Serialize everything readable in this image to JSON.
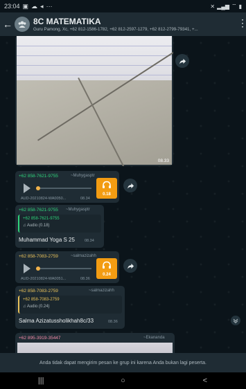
{
  "status_bar": {
    "time": "23:04",
    "left_icons": [
      "image-icon",
      "cloud-icon",
      "send-icon",
      "more-icon"
    ],
    "right_icons": [
      "mute-icon",
      "signal-icon",
      "wifi-icon",
      "battery-icon"
    ]
  },
  "header": {
    "title": "8C MATEMATIKA",
    "subtitle": "Guru Pamong, Xc, +62 812-1586-1782, +62 812-2597-1279, +62 812-2799-79341, +..."
  },
  "messages": {
    "image": {
      "time": "08.33"
    },
    "audio1": {
      "sender": "+62 858-7621-9755",
      "alias": "~Muhygasptr",
      "file": "AUD-20210824-WA0050...",
      "time": "08.34",
      "duration": "0.18"
    },
    "reply1": {
      "sender": "+62 858-7621-9755",
      "alias": "~Muhygasptr",
      "quote_sender": "+62 858-7621-9755",
      "quote_text": "Audio (0.18)",
      "text": "Muhammad Yoga S 25",
      "time": "08.34"
    },
    "audio2": {
      "sender": "+62 858-7083-2759",
      "alias": "~salmazizahh",
      "file": "AUD-20210824-WA0051...",
      "time": "08.36",
      "duration": "0.24"
    },
    "reply2": {
      "sender": "+62 858-7083-2759",
      "alias": "~salmazizahh",
      "quote_sender": "+62 858-7083-2759",
      "quote_text": "Audio (0.24)",
      "text": "Salma Azizatussholikhah8c/33",
      "time": "08.36"
    },
    "partial": {
      "sender": "+62 895-3919-35447",
      "alias": "~Ekananda"
    }
  },
  "footer": {
    "notice": "Anda tidak dapat mengirim pesan ke grup ini karena Anda bukan lagi peserta."
  },
  "navbar": {
    "recents": "|||",
    "home": "○",
    "back": "<"
  },
  "colors": {
    "header_bg": "#1f2c34",
    "bubble_bg": "#1f2c34",
    "audio_accent": "#f39c12",
    "sender_green": "#53bdeb",
    "sender_yellow": "#e8c15a",
    "sender_pink": "#f38ba8"
  }
}
